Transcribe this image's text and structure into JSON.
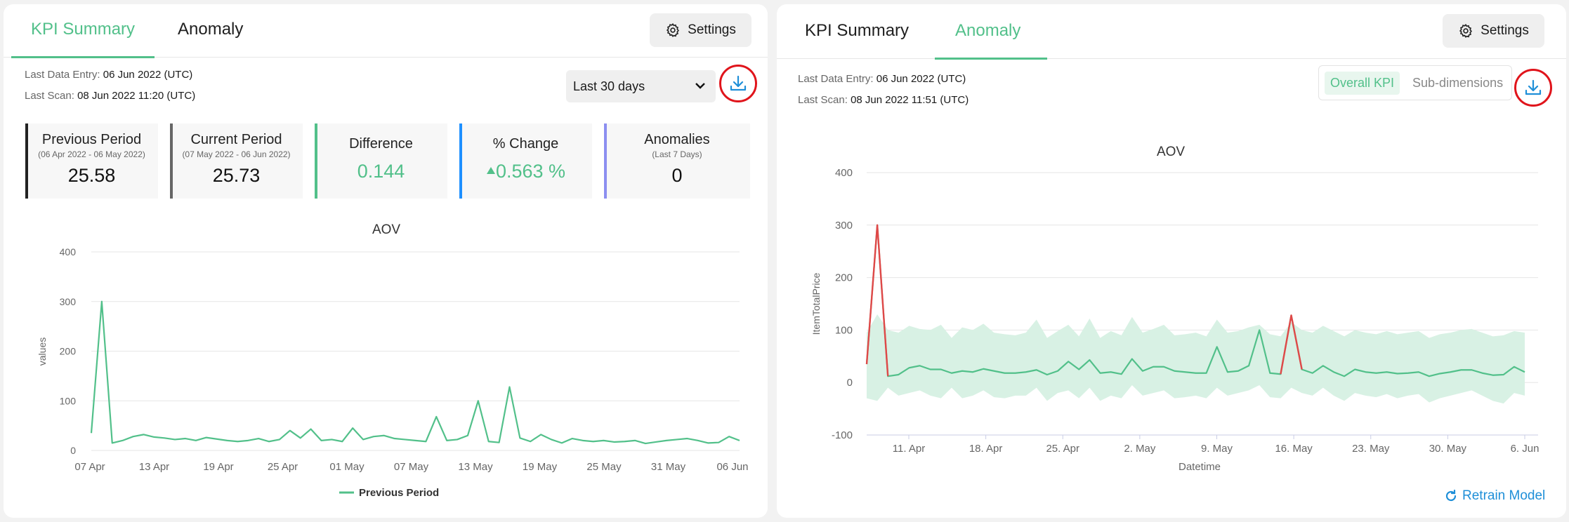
{
  "left": {
    "tabs": [
      {
        "label": "KPI Summary",
        "active": true
      },
      {
        "label": "Anomaly",
        "active": false
      }
    ],
    "settings_label": "Settings",
    "last_data_entry_label": "Last Data Entry:",
    "last_data_entry_value": "06 Jun 2022 (UTC)",
    "last_scan_label": "Last Scan:",
    "last_scan_value": "08 Jun 2022 11:20 (UTC)",
    "range_select": "Last 30 days",
    "cards": [
      {
        "title": "Previous Period",
        "sub": "(06 Apr 2022 - 06 May 2022)",
        "value": "25.58",
        "accent": "#222222"
      },
      {
        "title": "Current Period",
        "sub": "(07 May 2022 - 06 Jun 2022)",
        "value": "25.73",
        "accent": "#666666"
      },
      {
        "title": "Difference",
        "sub": "",
        "value": "0.144",
        "accent": "#52c08a"
      },
      {
        "title": "% Change",
        "sub": "",
        "value": "0.563 %",
        "accent": "#1e90ff"
      },
      {
        "title": "Anomalies",
        "sub": "(Last 7 Days)",
        "value": "0",
        "accent": "#8c8ff0"
      }
    ]
  },
  "right": {
    "tabs": [
      {
        "label": "KPI Summary",
        "active": false
      },
      {
        "label": "Anomaly",
        "active": true
      }
    ],
    "settings_label": "Settings",
    "last_data_entry_label": "Last Data Entry:",
    "last_data_entry_value": "06 Jun 2022 (UTC)",
    "last_scan_label": "Last Scan:",
    "last_scan_value": "08 Jun 2022 11:51 (UTC)",
    "toggle": [
      "Overall KPI",
      "Sub-dimensions"
    ],
    "retrain_label": "Retrain Model"
  },
  "colors": {
    "accent_green": "#52c08a",
    "anomaly_red": "#e04848",
    "band": "#d8f1e4",
    "highlight_ring": "#e0141b",
    "link_blue": "#1f8fd8"
  },
  "chart_data": [
    {
      "type": "line",
      "title": "AOV",
      "ylabel": "values",
      "xlabel": "",
      "ylim": [
        0,
        400
      ],
      "yticks": [
        0,
        100,
        200,
        300,
        400
      ],
      "x_tick_labels": [
        "07 Apr",
        "13 Apr",
        "19 Apr",
        "25 Apr",
        "01 May",
        "07 May",
        "13 May",
        "19 May",
        "25 May",
        "31 May",
        "06 Jun"
      ],
      "legend": "bottom-center",
      "series": [
        {
          "name": "Previous Period",
          "color": "#52c08a",
          "values": [
            35,
            300,
            15,
            20,
            28,
            32,
            27,
            25,
            22,
            24,
            20,
            26,
            23,
            20,
            18,
            20,
            24,
            18,
            22,
            40,
            25,
            43,
            20,
            22,
            18,
            45,
            22,
            28,
            30,
            24,
            22,
            20,
            18,
            68,
            20,
            22,
            30,
            100,
            18,
            16,
            128,
            25,
            18,
            32,
            22,
            15,
            24,
            20,
            18,
            20,
            17,
            18,
            20,
            14,
            17,
            20,
            22,
            24,
            20,
            15,
            16,
            28,
            20
          ]
        }
      ]
    },
    {
      "type": "line",
      "title": "AOV",
      "ylabel": "ItemTotalPrice",
      "xlabel": "Datetime",
      "ylim": [
        -100,
        400
      ],
      "yticks": [
        -100,
        0,
        100,
        200,
        300,
        400
      ],
      "x_tick_labels": [
        "11. Apr",
        "18. Apr",
        "25. Apr",
        "2. May",
        "9. May",
        "16. May",
        "23. May",
        "30. May",
        "6. Jun"
      ],
      "series": [
        {
          "name": "",
          "color": "#52c08a",
          "values": [
            35,
            300,
            12,
            15,
            28,
            32,
            25,
            25,
            18,
            22,
            20,
            26,
            22,
            18,
            18,
            20,
            24,
            15,
            22,
            40,
            25,
            43,
            18,
            20,
            16,
            45,
            22,
            30,
            30,
            22,
            20,
            18,
            18,
            68,
            20,
            22,
            32,
            100,
            18,
            16,
            128,
            25,
            18,
            32,
            20,
            12,
            25,
            20,
            18,
            20,
            17,
            18,
            20,
            12,
            17,
            20,
            24,
            24,
            18,
            14,
            15,
            30,
            20
          ]
        },
        {
          "name": "",
          "type": "band",
          "color": "#d8f1e4",
          "upper": [
            95,
            130,
            100,
            95,
            108,
            102,
            100,
            110,
            85,
            105,
            100,
            112,
            95,
            92,
            90,
            95,
            120,
            85,
            98,
            110,
            88,
            122,
            85,
            98,
            90,
            125,
            95,
            102,
            110,
            90,
            92,
            95,
            88,
            120,
            95,
            98,
            105,
            110,
            92,
            88,
            115,
            100,
            95,
            108,
            98,
            88,
            100,
            95,
            92,
            98,
            92,
            95,
            98,
            85,
            92,
            95,
            100,
            102,
            95,
            88,
            90,
            98,
            95
          ],
          "lower": [
            -30,
            -35,
            -10,
            -25,
            -20,
            -15,
            -25,
            -30,
            -10,
            -30,
            -25,
            -15,
            -28,
            -30,
            -25,
            -25,
            -10,
            -35,
            -20,
            -15,
            -30,
            -10,
            -35,
            -25,
            -30,
            -5,
            -25,
            -20,
            -15,
            -30,
            -28,
            -25,
            -30,
            -10,
            -25,
            -20,
            -15,
            -5,
            -28,
            -30,
            -10,
            -20,
            -25,
            -10,
            -25,
            -35,
            -20,
            -25,
            -28,
            -22,
            -30,
            -25,
            -22,
            -38,
            -30,
            -25,
            -20,
            -15,
            -25,
            -35,
            -40,
            -20,
            -25
          ]
        }
      ],
      "anomalies": [
        [
          0,
          1
        ],
        [
          39,
          40
        ]
      ]
    }
  ]
}
